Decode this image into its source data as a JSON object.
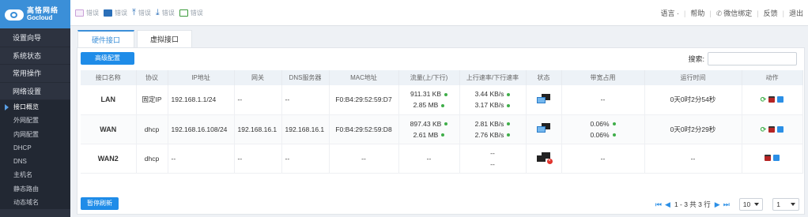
{
  "brand": {
    "cn": "高恪网络",
    "en": "Gocloud"
  },
  "sidebar": {
    "menu": [
      "设置向导",
      "系统状态",
      "常用操作",
      "网络设置"
    ],
    "sub": [
      "接口概览",
      "外网配置",
      "内网配置",
      "DHCP",
      "DNS",
      "主机名",
      "静态路由",
      "动态域名"
    ]
  },
  "toolbar": {
    "items": [
      "错误",
      "错误",
      "错误",
      "错误",
      "错误"
    ]
  },
  "topnav": {
    "lang": "语言 ·",
    "help": "帮助",
    "wechat": "微信绑定",
    "feedback": "反馈",
    "logout": "退出"
  },
  "tabs": {
    "hw": "硬件接口",
    "virt": "虚拟接口"
  },
  "buttons": {
    "advanced": "高级配置",
    "pause": "暂停刷新"
  },
  "search": {
    "label": "搜索:",
    "value": ""
  },
  "table": {
    "headers": [
      "接口名称",
      "协议",
      "IP地址",
      "网关",
      "DNS服务器",
      "MAC地址",
      "流量(上/下行)",
      "上行速率/下行速率",
      "状态",
      "带宽占用",
      "运行时间",
      "动作"
    ],
    "rows": [
      {
        "name": "LAN",
        "proto": "固定IP",
        "ip": "192.168.1.1/24",
        "gw": "--",
        "dns": "--",
        "mac": "F0:B4:29:52:59:D7",
        "tx": "911.31 KB",
        "rx": "2.85 MB",
        "up": "3.44 KB/s",
        "down": "3.17 KB/s",
        "bw1": "--",
        "bw2": "",
        "uptime": "0天0时2分54秒"
      },
      {
        "name": "WAN",
        "proto": "dhcp",
        "ip": "192.168.16.108/24",
        "gw": "192.168.16.1",
        "dns": "192.168.16.1",
        "mac": "F0:B4:29:52:59:D8",
        "tx": "897.43 KB",
        "rx": "2.61 MB",
        "up": "2.81 KB/s",
        "down": "2.76 KB/s",
        "bw1": "0.06%",
        "bw2": "0.06%",
        "uptime": "0天0时2分29秒"
      },
      {
        "name": "WAN2",
        "proto": "dhcp",
        "ip": "--",
        "gw": "--",
        "dns": "--",
        "mac": "--",
        "tx": "--",
        "rx": "",
        "up": "--",
        "down": "--",
        "bw1": "--",
        "bw2": "",
        "uptime": "--"
      }
    ]
  },
  "pager": {
    "info": "1 - 3 共 3 行",
    "page_size": "10",
    "page": "1"
  }
}
